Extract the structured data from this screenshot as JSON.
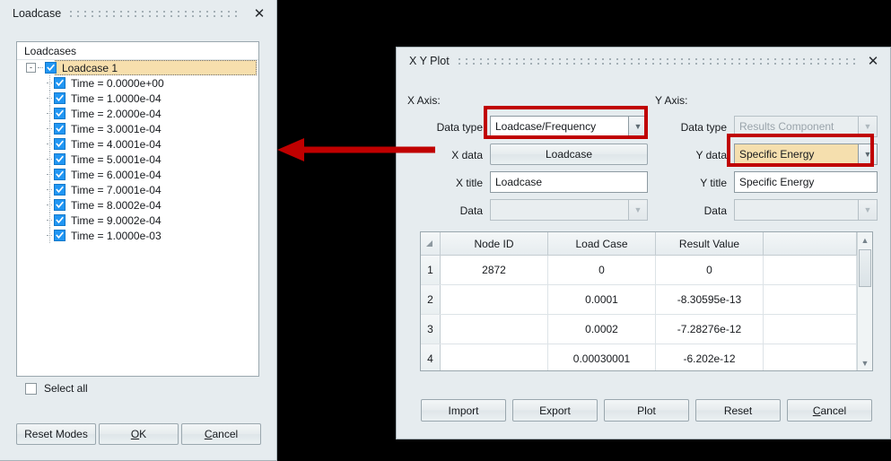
{
  "loadcase_dialog": {
    "title": "Loadcase",
    "close_icon": "close-icon",
    "list_header": "Loadcases",
    "root": {
      "label": "Loadcase 1",
      "checked": true,
      "expander": "-"
    },
    "items": [
      {
        "label": "Time = 0.0000e+00",
        "checked": true
      },
      {
        "label": "Time = 1.0000e-04",
        "checked": true
      },
      {
        "label": "Time = 2.0000e-04",
        "checked": true
      },
      {
        "label": "Time = 3.0001e-04",
        "checked": true
      },
      {
        "label": "Time = 4.0001e-04",
        "checked": true
      },
      {
        "label": "Time = 5.0001e-04",
        "checked": true
      },
      {
        "label": "Time = 6.0001e-04",
        "checked": true
      },
      {
        "label": "Time = 7.0001e-04",
        "checked": true
      },
      {
        "label": "Time = 8.0002e-04",
        "checked": true
      },
      {
        "label": "Time = 9.0002e-04",
        "checked": true
      },
      {
        "label": "Time = 1.0000e-03",
        "checked": true
      }
    ],
    "select_all": {
      "label": "Select all",
      "checked": false
    },
    "buttons": [
      {
        "label": "Reset Modes",
        "mnemonic": ""
      },
      {
        "label": "OK",
        "mnemonic": "O"
      },
      {
        "label": "Cancel",
        "mnemonic": "C"
      }
    ]
  },
  "xyplot_dialog": {
    "title": "X Y Plot",
    "close_icon": "close-icon",
    "x_axis": {
      "group_label": "X Axis:",
      "data_type_label": "Data type",
      "data_type_value": "Loadcase/Frequency",
      "data_label": "X data",
      "data_value": "Loadcase",
      "title_label": "X title",
      "title_value": "Loadcase",
      "extra_label": "Data",
      "extra_value": ""
    },
    "y_axis": {
      "group_label": "Y Axis:",
      "data_type_label": "Data type",
      "data_type_value": "Results Component",
      "data_label": "Y data",
      "data_value": "Specific Energy",
      "title_label": "Y title",
      "title_value": "Specific Energy",
      "extra_label": "Data",
      "extra_value": ""
    },
    "table": {
      "columns": [
        "",
        "Node ID",
        "Load Case",
        "Result Value",
        ""
      ],
      "rows": [
        {
          "num": "1",
          "node_id": "2872",
          "load_case": "0",
          "result_value": "0"
        },
        {
          "num": "2",
          "node_id": "",
          "load_case": "0.0001",
          "result_value": "-8.30595e-13"
        },
        {
          "num": "3",
          "node_id": "",
          "load_case": "0.0002",
          "result_value": "-7.28276e-12"
        },
        {
          "num": "4",
          "node_id": "",
          "load_case": "0.00030001",
          "result_value": "-6.202e-12"
        }
      ],
      "scroll_up_icon": "chevron-up-icon",
      "scroll_down_icon": "chevron-down-icon"
    },
    "buttons": [
      {
        "label": "Import",
        "mnemonic": ""
      },
      {
        "label": "Export",
        "mnemonic": ""
      },
      {
        "label": "Plot",
        "mnemonic": ""
      },
      {
        "label": "Reset",
        "mnemonic": ""
      },
      {
        "label": "Cancel",
        "mnemonic": "C"
      }
    ]
  },
  "annotations": {
    "highlight_color": "#c00000",
    "arrow_icon": "left-arrow-annotation",
    "boxes": [
      "x-data-type-combo",
      "y-data-combo"
    ]
  }
}
